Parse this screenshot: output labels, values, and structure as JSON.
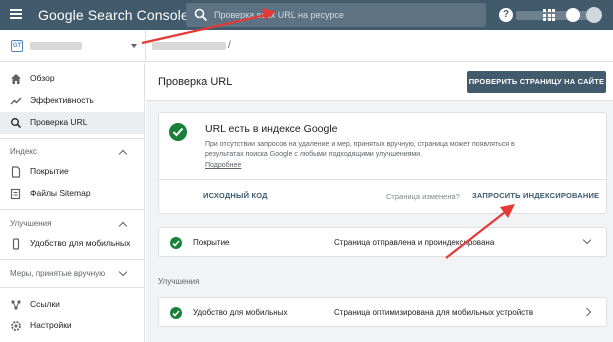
{
  "app": {
    "title": "Google Search Console"
  },
  "search": {
    "placeholder": "Проверка всех URL на ресурсе"
  },
  "property": {
    "favicon_text": "GT",
    "url_suffix": "/"
  },
  "sidebar": {
    "items": [
      {
        "label": "Обзор",
        "icon": "home-icon"
      },
      {
        "label": "Эффективность",
        "icon": "trending-up-icon"
      },
      {
        "label": "Проверка URL",
        "icon": "search-icon",
        "active": true
      }
    ],
    "index_section": {
      "title": "Индекс",
      "items": [
        {
          "label": "Покрытие",
          "icon": "document-icon"
        },
        {
          "label": "Файлы Sitemap",
          "icon": "sitemap-icon"
        }
      ]
    },
    "enhancements_section": {
      "title": "Улучшения",
      "items": [
        {
          "label": "Удобство для мобильных",
          "icon": "mobile-icon"
        }
      ]
    },
    "manual_section": {
      "title": "Меры, принятые вручную"
    },
    "bottom_items": [
      {
        "label": "Ссылки",
        "icon": "links-icon"
      },
      {
        "label": "Настройки",
        "icon": "gear-icon"
      }
    ]
  },
  "main": {
    "title": "Проверка URL",
    "test_button": "ПРОВЕРИТЬ СТРАНИЦУ НА САЙТЕ",
    "status_card": {
      "title": "URL есть в индексе Google",
      "description": "При отсутствии запросов на удаление и мер, принятых вручную, страница может появляться в результатах поиска Google с любыми подходящими улучшениями.",
      "link": "Подробнее",
      "source_button": "ИСХОДНЫЙ КОД",
      "changed_text": "Страница изменена?",
      "request_button": "ЗАПРОСИТЬ ИНДЕКСИРОВАНИЕ"
    },
    "coverage_row": {
      "label": "Покрытие",
      "value": "Страница отправлена и проиндексирована"
    },
    "enhancements_label": "Улучшения",
    "mobile_row": {
      "label": "Удобство для мобильных",
      "value": "Страница оптимизирована для мобильных устройств"
    }
  },
  "colors": {
    "topbar": "#415a6c",
    "success": "#188038",
    "annotation": "#e53935"
  }
}
